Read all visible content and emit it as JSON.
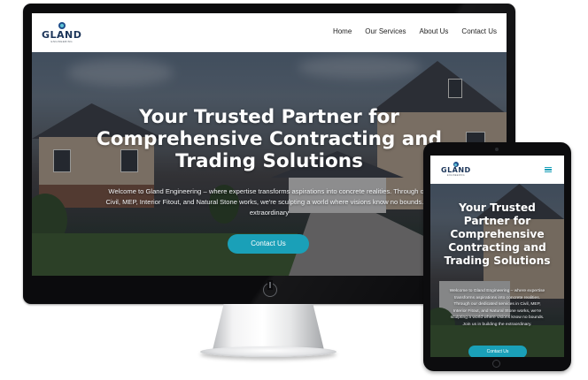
{
  "site": {
    "logo_text": "GLAND",
    "logo_subtext": "ENGINEERING",
    "nav": [
      "Home",
      "Our Services",
      "About Us",
      "Contact Us"
    ],
    "hero_title_lines": [
      "Your Trusted Partner for",
      "Comprehensive Contracting and",
      "Trading Solutions"
    ],
    "hero_text_lines": [
      "Welcome to Gland Engineering – where expertise transforms aspirations into concrete realities. Through our",
      "Civil, MEP, Interior Fitout, and Natural Stone works, we're sculpting a world where visions know no bounds. Jo",
      "extraordinary"
    ],
    "cta_label": "Contact Us",
    "accent_color": "#1aa0b8"
  },
  "tablet": {
    "hero_title_lines": [
      "Your Trusted",
      "Partner for",
      "Comprehensive",
      "Contracting and",
      "Trading Solutions"
    ],
    "hero_text_lines": [
      "Welcome to Gland Engineering – where expertise",
      "transforms aspirations into concrete realities.",
      "Through our dedicated services in Civil, MEP,",
      "Interior Fitout, and Natural Stone works, we're",
      "sculpting a world where visions know no bounds.",
      "Join us in building the extraordinary."
    ],
    "menu_icon": "hamburger-menu-icon"
  },
  "devices": {
    "monitor_power_icon": "power-icon",
    "tablet_camera": "camera-dot",
    "tablet_home_button": "home-button"
  }
}
